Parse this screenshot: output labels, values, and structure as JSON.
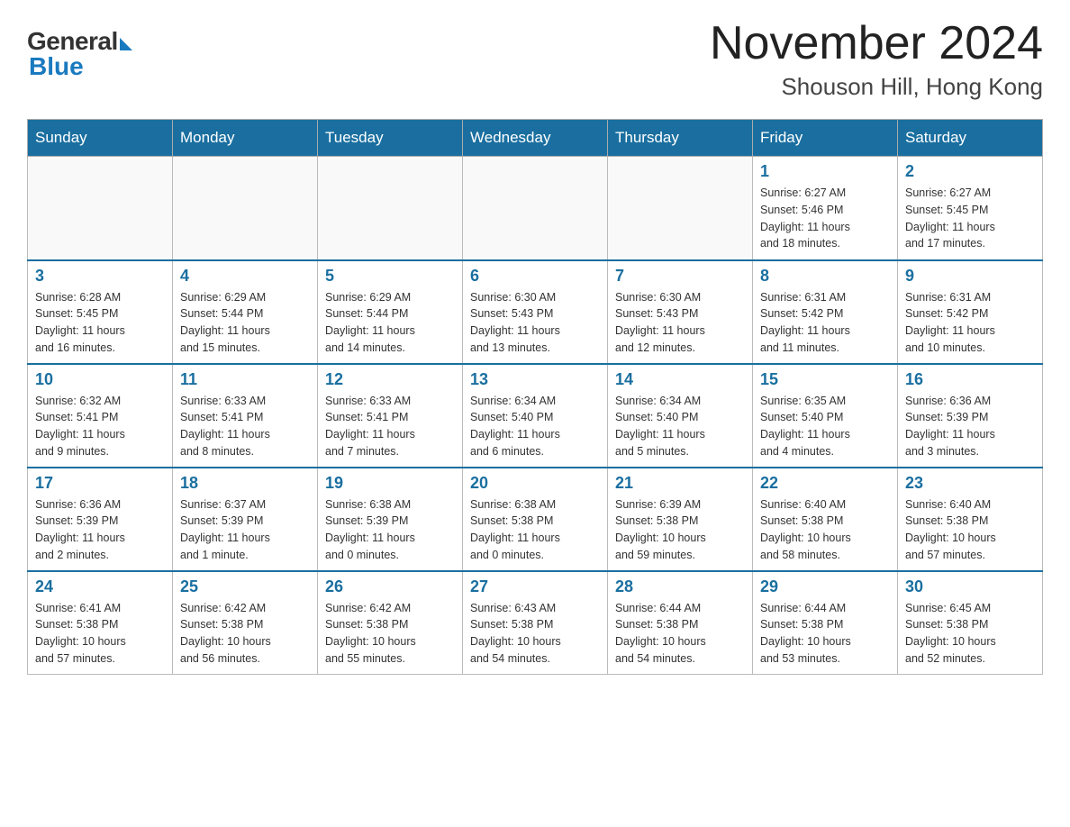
{
  "logo": {
    "general": "General",
    "blue": "Blue"
  },
  "title": "November 2024",
  "subtitle": "Shouson Hill, Hong Kong",
  "days_of_week": [
    "Sunday",
    "Monday",
    "Tuesday",
    "Wednesday",
    "Thursday",
    "Friday",
    "Saturday"
  ],
  "weeks": [
    [
      {
        "day": "",
        "info": ""
      },
      {
        "day": "",
        "info": ""
      },
      {
        "day": "",
        "info": ""
      },
      {
        "day": "",
        "info": ""
      },
      {
        "day": "",
        "info": ""
      },
      {
        "day": "1",
        "info": "Sunrise: 6:27 AM\nSunset: 5:46 PM\nDaylight: 11 hours\nand 18 minutes."
      },
      {
        "day": "2",
        "info": "Sunrise: 6:27 AM\nSunset: 5:45 PM\nDaylight: 11 hours\nand 17 minutes."
      }
    ],
    [
      {
        "day": "3",
        "info": "Sunrise: 6:28 AM\nSunset: 5:45 PM\nDaylight: 11 hours\nand 16 minutes."
      },
      {
        "day": "4",
        "info": "Sunrise: 6:29 AM\nSunset: 5:44 PM\nDaylight: 11 hours\nand 15 minutes."
      },
      {
        "day": "5",
        "info": "Sunrise: 6:29 AM\nSunset: 5:44 PM\nDaylight: 11 hours\nand 14 minutes."
      },
      {
        "day": "6",
        "info": "Sunrise: 6:30 AM\nSunset: 5:43 PM\nDaylight: 11 hours\nand 13 minutes."
      },
      {
        "day": "7",
        "info": "Sunrise: 6:30 AM\nSunset: 5:43 PM\nDaylight: 11 hours\nand 12 minutes."
      },
      {
        "day": "8",
        "info": "Sunrise: 6:31 AM\nSunset: 5:42 PM\nDaylight: 11 hours\nand 11 minutes."
      },
      {
        "day": "9",
        "info": "Sunrise: 6:31 AM\nSunset: 5:42 PM\nDaylight: 11 hours\nand 10 minutes."
      }
    ],
    [
      {
        "day": "10",
        "info": "Sunrise: 6:32 AM\nSunset: 5:41 PM\nDaylight: 11 hours\nand 9 minutes."
      },
      {
        "day": "11",
        "info": "Sunrise: 6:33 AM\nSunset: 5:41 PM\nDaylight: 11 hours\nand 8 minutes."
      },
      {
        "day": "12",
        "info": "Sunrise: 6:33 AM\nSunset: 5:41 PM\nDaylight: 11 hours\nand 7 minutes."
      },
      {
        "day": "13",
        "info": "Sunrise: 6:34 AM\nSunset: 5:40 PM\nDaylight: 11 hours\nand 6 minutes."
      },
      {
        "day": "14",
        "info": "Sunrise: 6:34 AM\nSunset: 5:40 PM\nDaylight: 11 hours\nand 5 minutes."
      },
      {
        "day": "15",
        "info": "Sunrise: 6:35 AM\nSunset: 5:40 PM\nDaylight: 11 hours\nand 4 minutes."
      },
      {
        "day": "16",
        "info": "Sunrise: 6:36 AM\nSunset: 5:39 PM\nDaylight: 11 hours\nand 3 minutes."
      }
    ],
    [
      {
        "day": "17",
        "info": "Sunrise: 6:36 AM\nSunset: 5:39 PM\nDaylight: 11 hours\nand 2 minutes."
      },
      {
        "day": "18",
        "info": "Sunrise: 6:37 AM\nSunset: 5:39 PM\nDaylight: 11 hours\nand 1 minute."
      },
      {
        "day": "19",
        "info": "Sunrise: 6:38 AM\nSunset: 5:39 PM\nDaylight: 11 hours\nand 0 minutes."
      },
      {
        "day": "20",
        "info": "Sunrise: 6:38 AM\nSunset: 5:38 PM\nDaylight: 11 hours\nand 0 minutes."
      },
      {
        "day": "21",
        "info": "Sunrise: 6:39 AM\nSunset: 5:38 PM\nDaylight: 10 hours\nand 59 minutes."
      },
      {
        "day": "22",
        "info": "Sunrise: 6:40 AM\nSunset: 5:38 PM\nDaylight: 10 hours\nand 58 minutes."
      },
      {
        "day": "23",
        "info": "Sunrise: 6:40 AM\nSunset: 5:38 PM\nDaylight: 10 hours\nand 57 minutes."
      }
    ],
    [
      {
        "day": "24",
        "info": "Sunrise: 6:41 AM\nSunset: 5:38 PM\nDaylight: 10 hours\nand 57 minutes."
      },
      {
        "day": "25",
        "info": "Sunrise: 6:42 AM\nSunset: 5:38 PM\nDaylight: 10 hours\nand 56 minutes."
      },
      {
        "day": "26",
        "info": "Sunrise: 6:42 AM\nSunset: 5:38 PM\nDaylight: 10 hours\nand 55 minutes."
      },
      {
        "day": "27",
        "info": "Sunrise: 6:43 AM\nSunset: 5:38 PM\nDaylight: 10 hours\nand 54 minutes."
      },
      {
        "day": "28",
        "info": "Sunrise: 6:44 AM\nSunset: 5:38 PM\nDaylight: 10 hours\nand 54 minutes."
      },
      {
        "day": "29",
        "info": "Sunrise: 6:44 AM\nSunset: 5:38 PM\nDaylight: 10 hours\nand 53 minutes."
      },
      {
        "day": "30",
        "info": "Sunrise: 6:45 AM\nSunset: 5:38 PM\nDaylight: 10 hours\nand 52 minutes."
      }
    ]
  ]
}
